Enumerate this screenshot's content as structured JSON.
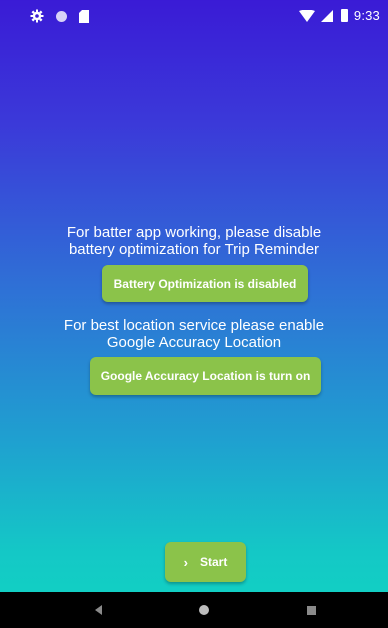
{
  "status_bar": {
    "icons_left": [
      "gear-icon",
      "dot-icon",
      "sd-card-icon"
    ],
    "icons_right": [
      "wifi-icon",
      "signal-icon",
      "battery-icon"
    ],
    "time": "9:33"
  },
  "battery_section": {
    "line1": "For batter app working, please disable",
    "line2": "battery optimization for Trip Reminder",
    "button_label": "Battery Optimization is disabled"
  },
  "location_section": {
    "line1": "For best location service please enable",
    "line2": "Google Accuracy Location",
    "button_label": "Google Accuracy Location is turn on"
  },
  "start_button": {
    "icon": "chevron-right-icon",
    "label": "Start"
  },
  "nav_bar": {
    "icons": [
      "back-icon",
      "home-icon",
      "recents-icon"
    ]
  },
  "colors": {
    "gradient_top": "#3a1bd6",
    "gradient_bottom": "#10d5c2",
    "button_green": "#8bc34a",
    "nav_bar": "#000000"
  }
}
